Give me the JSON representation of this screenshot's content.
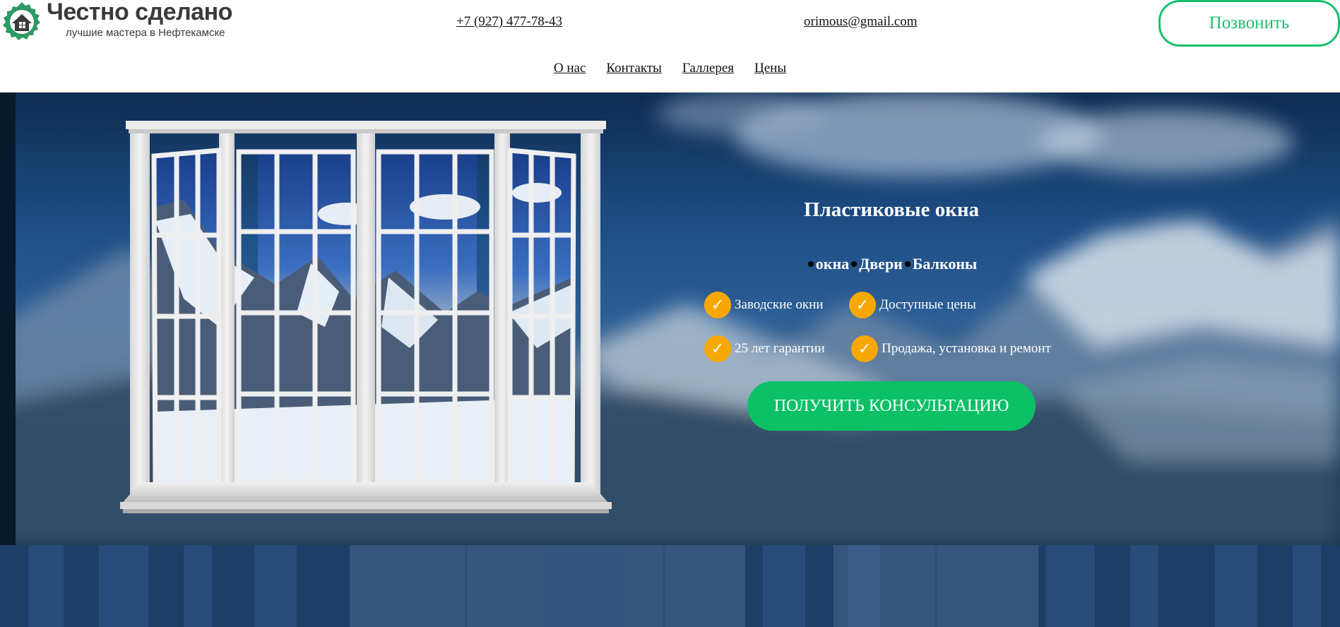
{
  "brand": {
    "title": "Честно сделано",
    "subtitle": "лучшие мастера в Нефтекамске",
    "logo_icon": "house-gear-icon",
    "accent_color": "#1bbf6e"
  },
  "header": {
    "phone": "+7 (927) 477-78-43",
    "email": "orimous@gmail.com",
    "call_button": "Позвонить"
  },
  "nav": {
    "items": [
      {
        "label": "О нас"
      },
      {
        "label": "Контакты"
      },
      {
        "label": "Галлерея"
      },
      {
        "label": "Цены"
      }
    ]
  },
  "hero": {
    "title": "Пластиковые окна",
    "tags": [
      "окна",
      "Двери",
      "Балконы"
    ],
    "features": [
      {
        "label": "Заводские окни",
        "icon": "check-icon"
      },
      {
        "label": "Доступные цены",
        "icon": "check-icon"
      },
      {
        "label": "25 лет гарантии",
        "icon": "check-icon"
      },
      {
        "label": "Продажа, установка и ремонт",
        "icon": "check-icon"
      }
    ],
    "cta_button": "ПОЛУЧИТЬ КОНСУЛЬТАЦИЮ",
    "cta_color": "#0cc066",
    "check_color": "#f7a800"
  }
}
